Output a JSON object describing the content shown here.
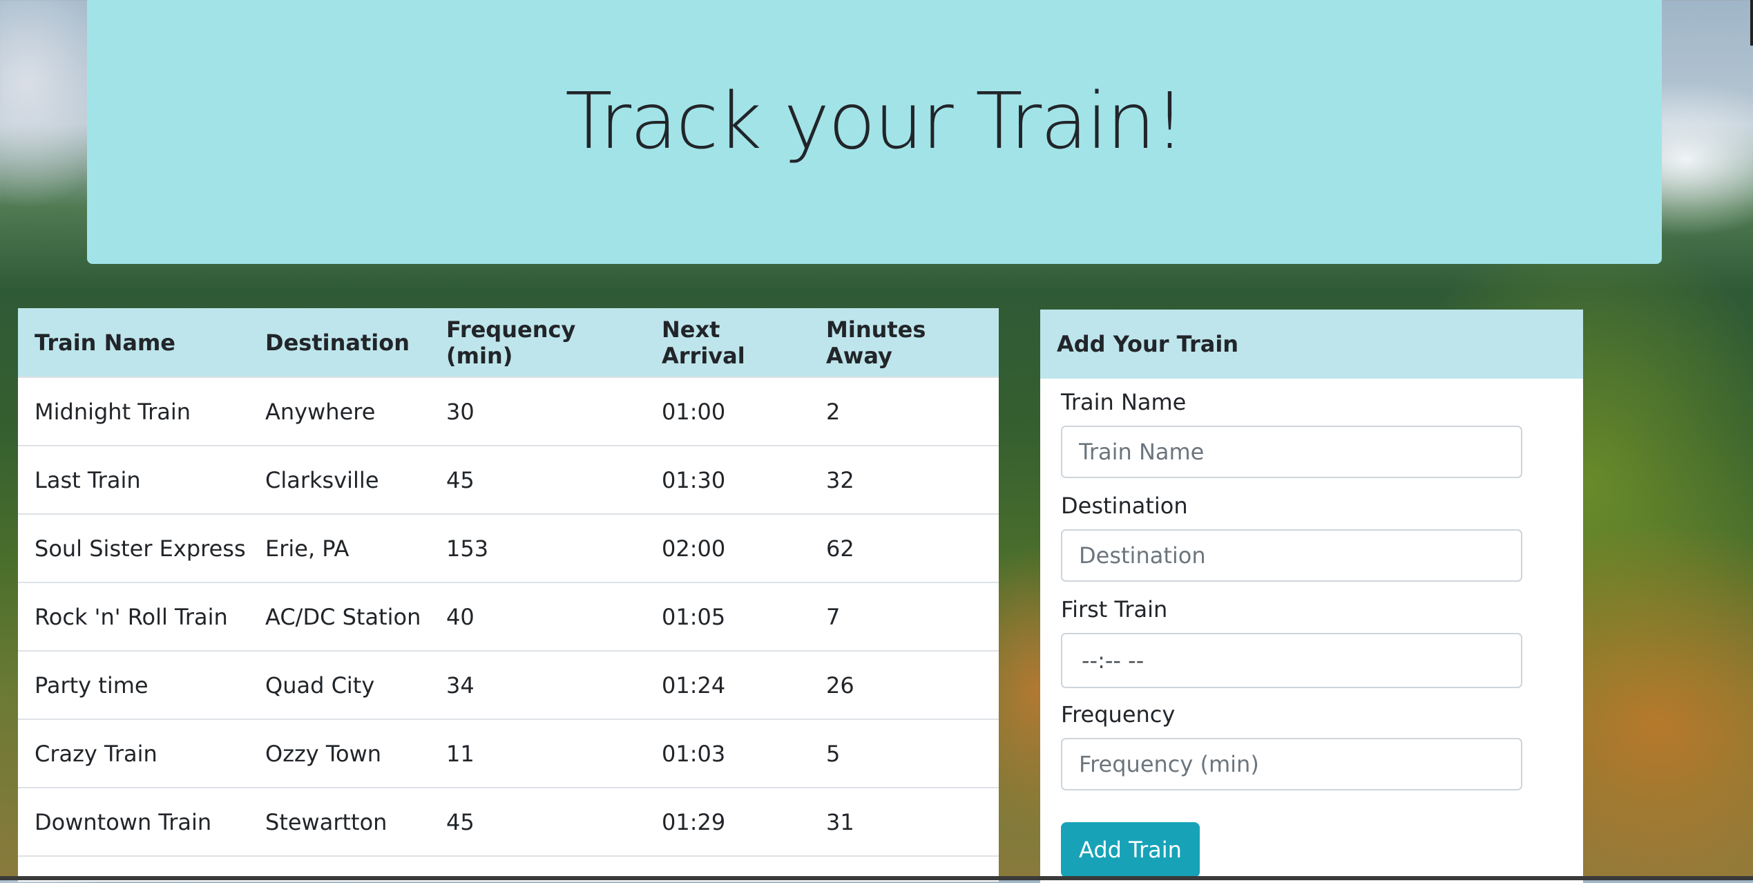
{
  "header": {
    "title": "Track your Train!"
  },
  "schedule": {
    "columns": [
      "Train Name",
      "Destination",
      "Frequency (min)",
      "Next Arrival",
      "Minutes Away"
    ],
    "rows": [
      [
        "Midnight Train",
        "Anywhere",
        "30",
        "01:00",
        "2"
      ],
      [
        "Last Train",
        "Clarksville",
        "45",
        "01:30",
        "32"
      ],
      [
        "Soul Sister Express",
        "Erie, PA",
        "153",
        "02:00",
        "62"
      ],
      [
        "Rock 'n' Roll Train",
        "AC/DC Station",
        "40",
        "01:05",
        "7"
      ],
      [
        "Party time",
        "Quad City",
        "34",
        "01:24",
        "26"
      ],
      [
        "Crazy Train",
        "Ozzy Town",
        "11",
        "01:03",
        "5"
      ],
      [
        "Downtown Train",
        "Stewartton",
        "45",
        "01:29",
        "31"
      ]
    ]
  },
  "form": {
    "title": "Add Your Train",
    "name_label": "Train Name",
    "name_placeholder": "Train Name",
    "destination_label": "Destination",
    "destination_placeholder": "Destination",
    "first_train_label": "First Train",
    "first_train_value": "--:-- --",
    "frequency_label": "Frequency",
    "frequency_placeholder": "Frequency (min)",
    "submit_label": "Add Train"
  },
  "colors": {
    "jumbotron": "#a2e3e8",
    "table_header": "#bee5eb",
    "button": "#17a2b8"
  }
}
